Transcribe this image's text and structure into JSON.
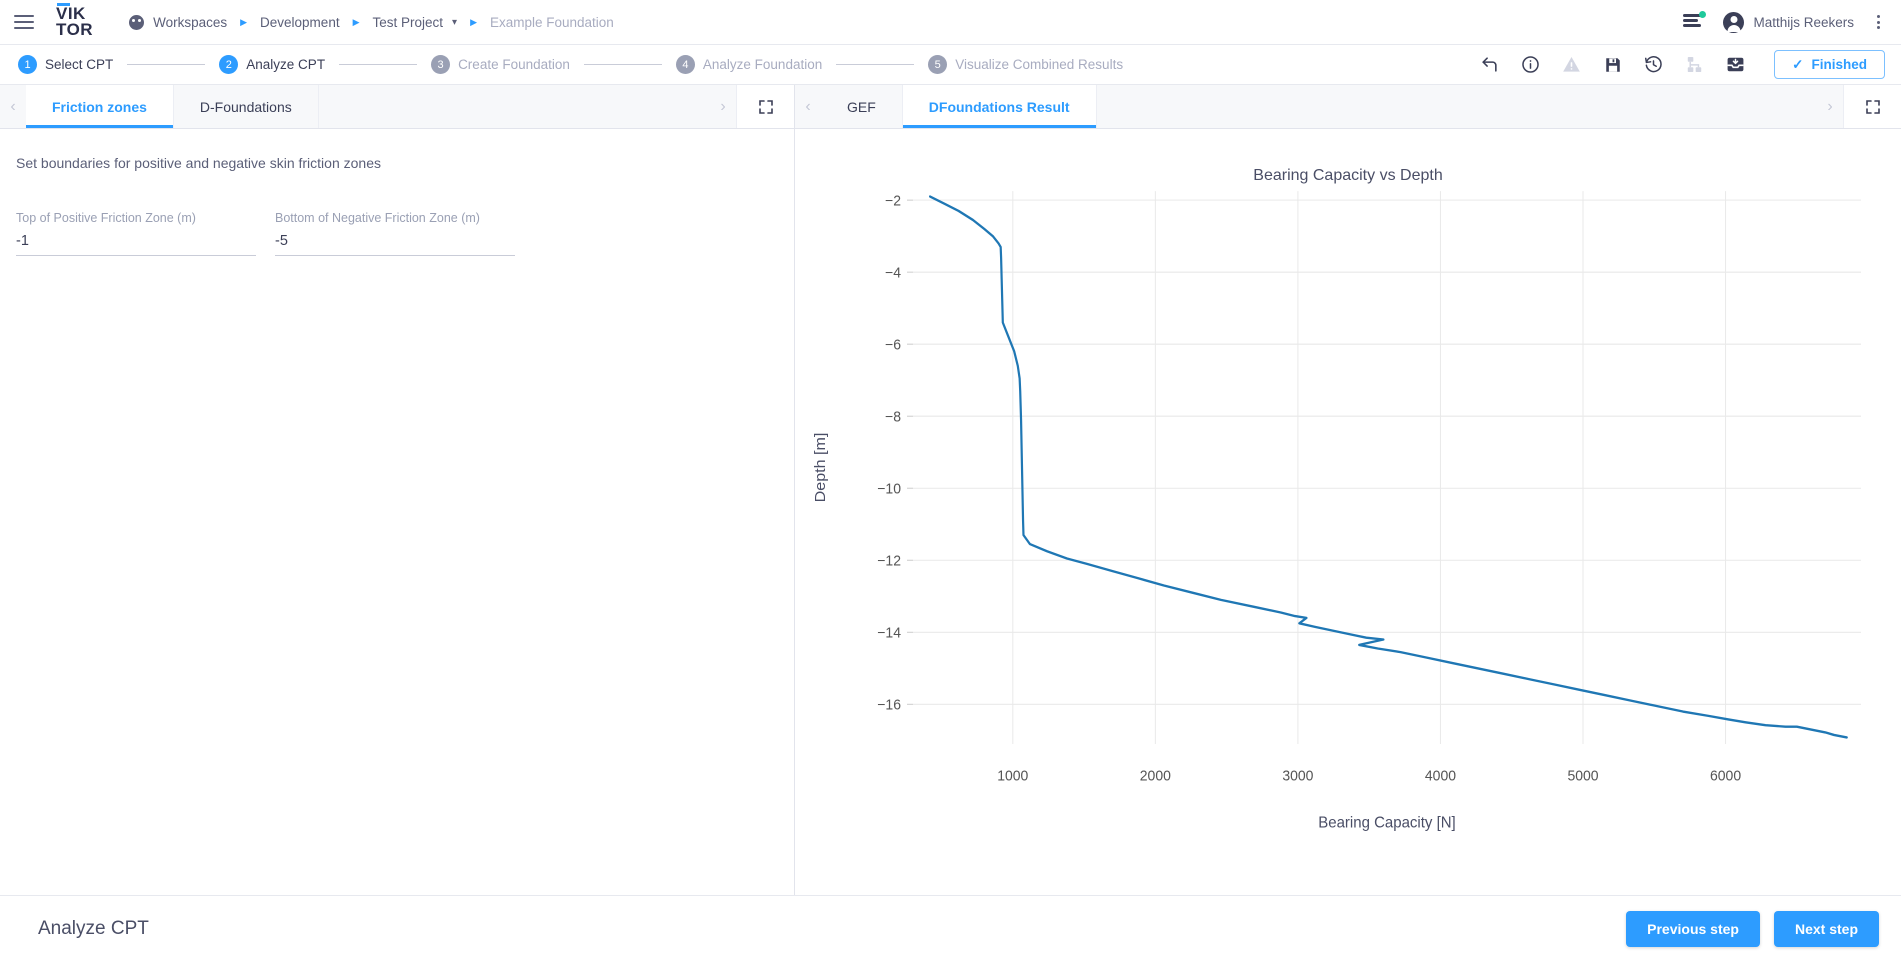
{
  "header": {
    "menu_icon": "hamburger-icon",
    "logo_line1": "VIK",
    "logo_line2": "TOR",
    "breadcrumbs": [
      {
        "label": "Workspaces",
        "icon": "workspaces-icon",
        "muted": false,
        "caret": false
      },
      {
        "label": "Development",
        "muted": false,
        "caret": false
      },
      {
        "label": "Test Project",
        "muted": false,
        "caret": true
      },
      {
        "label": "Example Foundation",
        "muted": true,
        "caret": false
      }
    ],
    "notifications_icon": "notifications-list-icon",
    "user_name": "Matthijs Reekers",
    "avatar_icon": "user-avatar-icon",
    "overflow_icon": "kebab-menu-icon",
    "accent_color": "#2d9cff",
    "badge_color": "#1fc99b"
  },
  "steps": [
    {
      "num": "1",
      "label": "Select CPT",
      "state": "active"
    },
    {
      "num": "2",
      "label": "Analyze CPT",
      "state": "active"
    },
    {
      "num": "3",
      "label": "Create Foundation",
      "state": "inactive"
    },
    {
      "num": "4",
      "label": "Analyze Foundation",
      "state": "inactive"
    },
    {
      "num": "5",
      "label": "Visualize Combined Results",
      "state": "inactive"
    }
  ],
  "toolbar": {
    "icons": [
      {
        "name": "return-arrow-icon",
        "disabled": false
      },
      {
        "name": "info-circle-icon",
        "disabled": false
      },
      {
        "name": "warning-triangle-icon",
        "disabled": true
      },
      {
        "name": "save-floppy-icon",
        "disabled": false
      },
      {
        "name": "history-clock-icon",
        "disabled": false
      },
      {
        "name": "sitemap-icon",
        "disabled": true
      },
      {
        "name": "inbox-tray-icon",
        "disabled": false
      }
    ],
    "finished_label": "Finished",
    "finished_icon": "check-icon"
  },
  "left_panel": {
    "tabs": [
      {
        "label": "Friction zones",
        "active": true
      },
      {
        "label": "D-Foundations",
        "active": false
      }
    ],
    "prev_arrow": "chevron-left-icon",
    "next_arrow": "chevron-right-icon",
    "expand_icon": "fullscreen-icon",
    "description": "Set boundaries for positive and negative skin friction zones",
    "fields": [
      {
        "label": "Top of Positive Friction Zone (m)",
        "value": "-1"
      },
      {
        "label": "Bottom of Negative Friction Zone (m)",
        "value": "-5"
      }
    ]
  },
  "right_panel": {
    "tabs": [
      {
        "label": "GEF",
        "active": false
      },
      {
        "label": "DFoundations Result",
        "active": true
      }
    ],
    "prev_arrow": "chevron-left-icon",
    "next_arrow": "chevron-right-icon",
    "expand_icon": "fullscreen-icon"
  },
  "footer": {
    "title": "Analyze CPT",
    "previous_label": "Previous step",
    "next_label": "Next step"
  },
  "chart_data": {
    "type": "line",
    "title": "Bearing Capacity vs Depth",
    "xlabel": "Bearing Capacity [N]",
    "ylabel": "Depth [m]",
    "xlim": [
      300,
      6950
    ],
    "ylim": [
      -17.1,
      -1.75
    ],
    "xticks": [
      1000,
      2000,
      3000,
      4000,
      5000,
      6000
    ],
    "yticks": [
      -2,
      -4,
      -6,
      -8,
      -10,
      -12,
      -14,
      -16
    ],
    "grid": true,
    "legend": false,
    "line_color": "#1f77b4",
    "series": [
      {
        "name": "Bearing capacity",
        "x": [
          420,
          520,
          620,
          720,
          800,
          860,
          900,
          915,
          918,
          920,
          922,
          924,
          926,
          928,
          930,
          960,
          1010,
          1035,
          1048,
          1052,
          1055,
          1058,
          1060,
          1062,
          1064,
          1066,
          1068,
          1070,
          1072,
          1075,
          1120,
          1240,
          1380,
          1520,
          1700,
          1880,
          2060,
          2260,
          2460,
          2700,
          2880,
          2980,
          3060,
          3010,
          3120,
          3240,
          3360,
          3480,
          3600,
          3430,
          3560,
          3720,
          3900,
          4080,
          4260,
          4440,
          4620,
          4800,
          4980,
          5160,
          5340,
          5520,
          5700,
          5880,
          6020,
          6140,
          6280,
          6420,
          6500,
          6600,
          6700,
          6760,
          6850
        ],
        "y": [
          -1.9,
          -2.1,
          -2.3,
          -2.55,
          -2.8,
          -3.0,
          -3.2,
          -3.3,
          -3.6,
          -3.9,
          -4.2,
          -4.5,
          -4.8,
          -5.1,
          -5.4,
          -5.7,
          -6.2,
          -6.6,
          -6.95,
          -7.3,
          -7.7,
          -8.1,
          -8.5,
          -8.9,
          -9.3,
          -9.7,
          -10.1,
          -10.5,
          -10.9,
          -11.3,
          -11.55,
          -11.75,
          -11.95,
          -12.1,
          -12.3,
          -12.5,
          -12.7,
          -12.9,
          -13.1,
          -13.3,
          -13.45,
          -13.55,
          -13.6,
          -13.75,
          -13.85,
          -13.95,
          -14.05,
          -14.15,
          -14.2,
          -14.35,
          -14.45,
          -14.55,
          -14.7,
          -14.85,
          -15.0,
          -15.15,
          -15.3,
          -15.45,
          -15.6,
          -15.75,
          -15.9,
          -16.05,
          -16.2,
          -16.32,
          -16.42,
          -16.5,
          -16.58,
          -16.62,
          -16.62,
          -16.7,
          -16.78,
          -16.85,
          -16.92
        ]
      }
    ]
  }
}
